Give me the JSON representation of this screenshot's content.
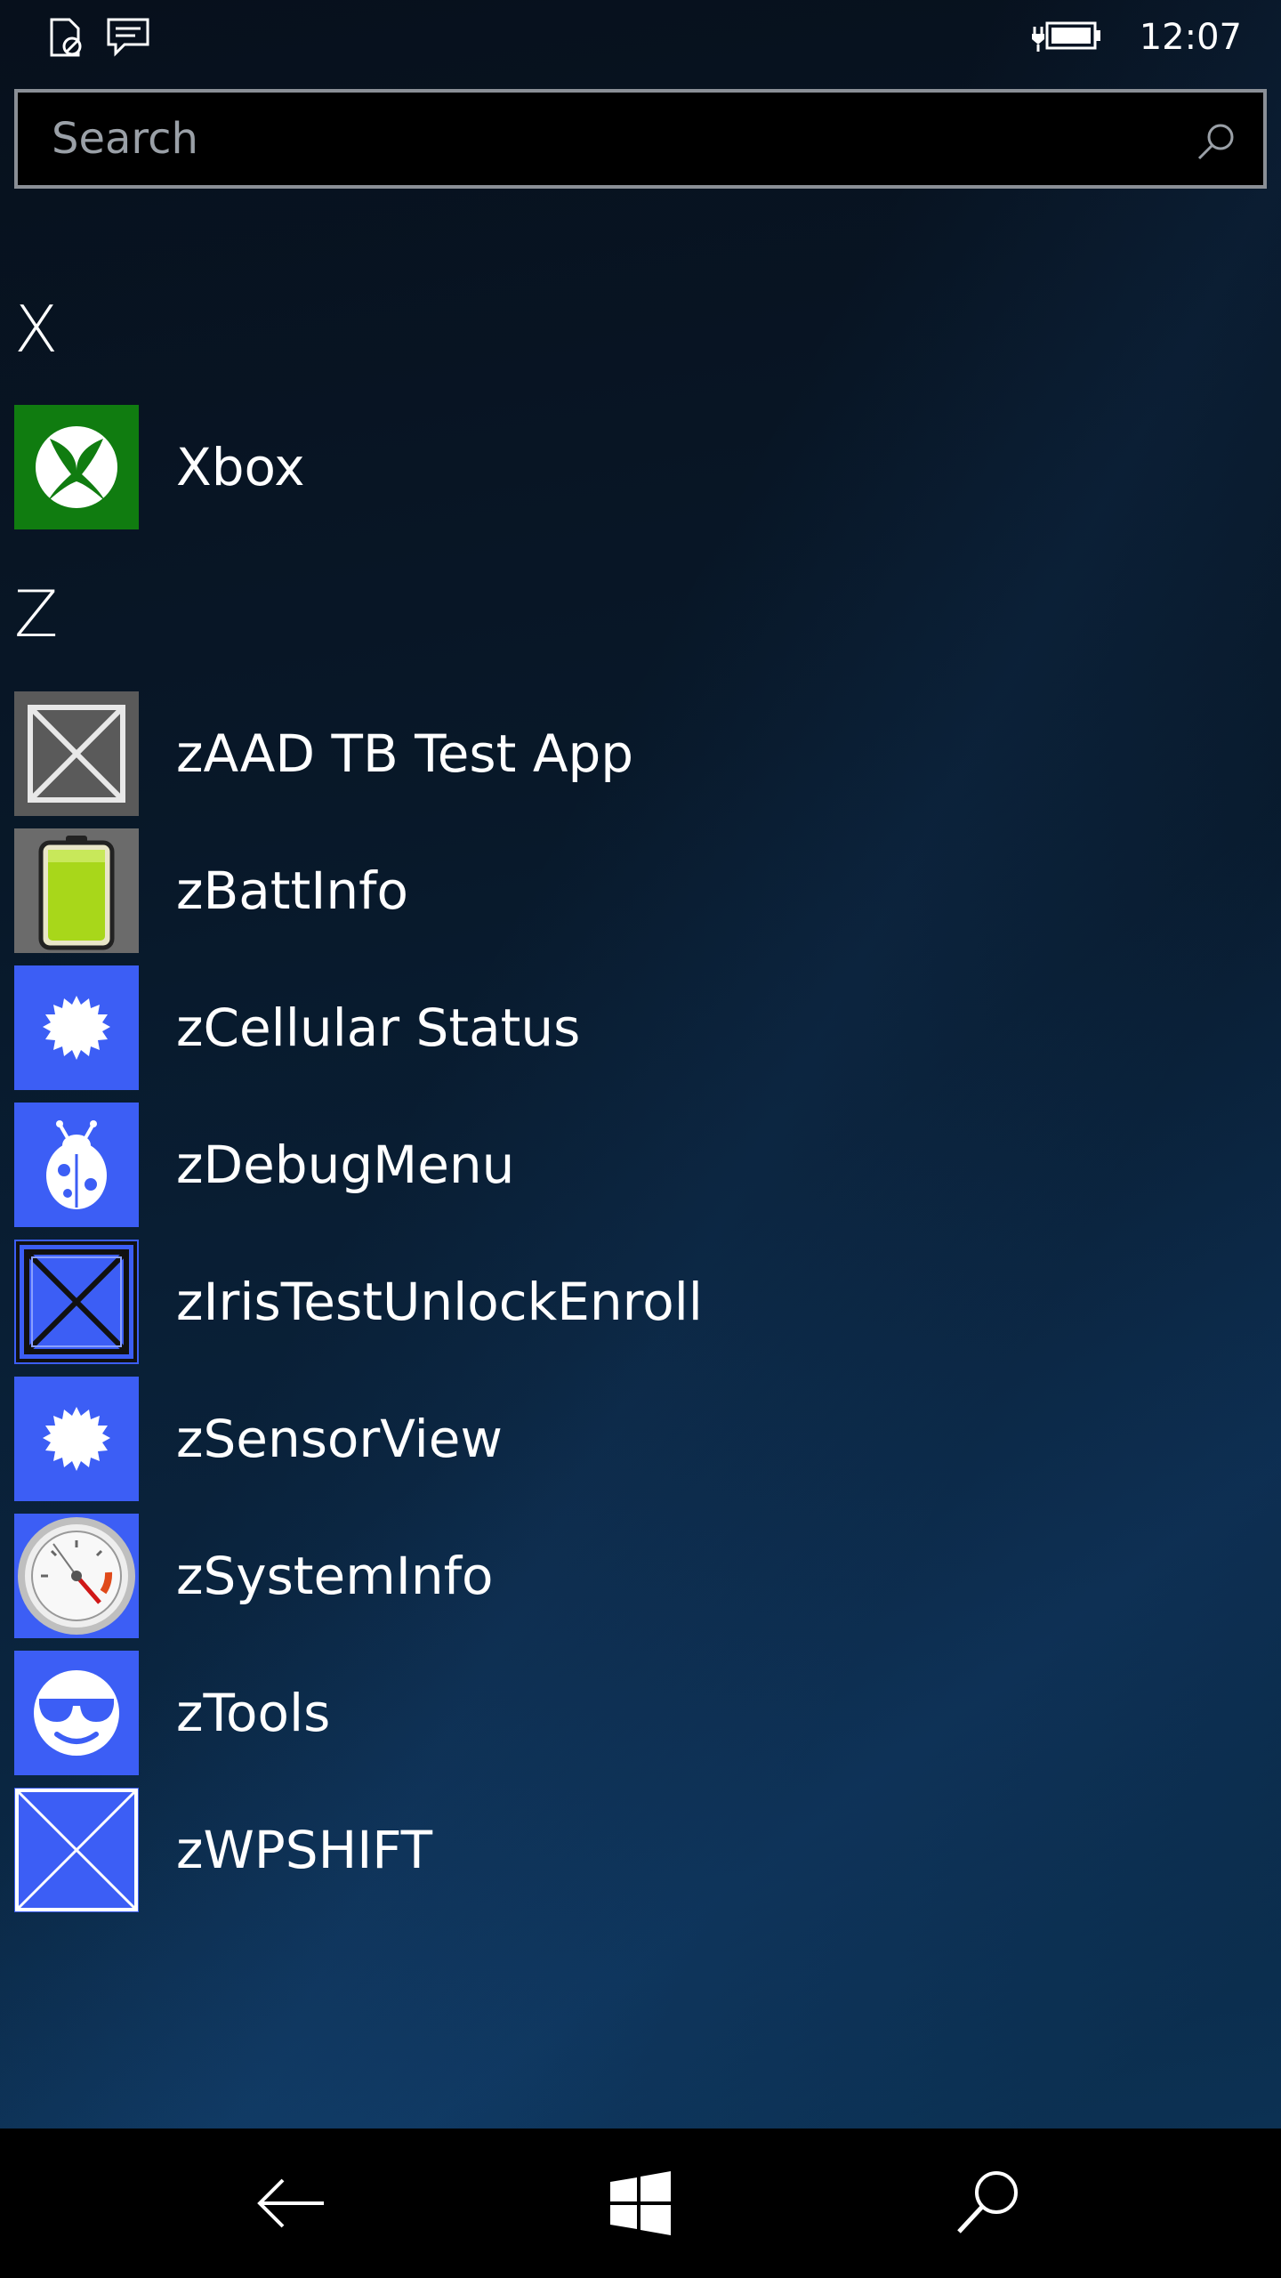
{
  "status_bar": {
    "time": "12:07",
    "icons": [
      "sim-card-blocked-icon",
      "message-icon",
      "battery-charging-icon"
    ]
  },
  "search": {
    "placeholder": "Search",
    "value": "",
    "icon": "search-icon"
  },
  "groups": [
    {
      "letter": "X",
      "apps": [
        {
          "name": "Xbox",
          "icon": "xbox-icon",
          "tile_color": "#107c10"
        }
      ]
    },
    {
      "letter": "Z",
      "apps": [
        {
          "name": "zAAD TB Test App",
          "icon": "placeholder-x-icon",
          "tile_color": "#5a5a5a"
        },
        {
          "name": "zBattInfo",
          "icon": "battery-icon",
          "tile_color": "#6b6b6b"
        },
        {
          "name": "zCellular Status",
          "icon": "starburst-icon",
          "tile_color": "#3c5ef5"
        },
        {
          "name": "zDebugMenu",
          "icon": "bug-icon",
          "tile_color": "#3c5ef5"
        },
        {
          "name": "zIrisTestUnlockEnroll",
          "icon": "placeholder-x-icon",
          "tile_color": "#3c5ef5"
        },
        {
          "name": "zSensorView",
          "icon": "starburst-icon",
          "tile_color": "#3c5ef5"
        },
        {
          "name": "zSystemInfo",
          "icon": "gauge-icon",
          "tile_color": "#3c5ef5"
        },
        {
          "name": "zTools",
          "icon": "sunglasses-face-icon",
          "tile_color": "#3c5ef5"
        },
        {
          "name": "zWPSHIFT",
          "icon": "placeholder-x-icon",
          "tile_color": "#3c5ef5"
        }
      ]
    }
  ],
  "nav_bar": {
    "buttons": [
      "back-icon",
      "windows-start-icon",
      "search-icon"
    ]
  }
}
